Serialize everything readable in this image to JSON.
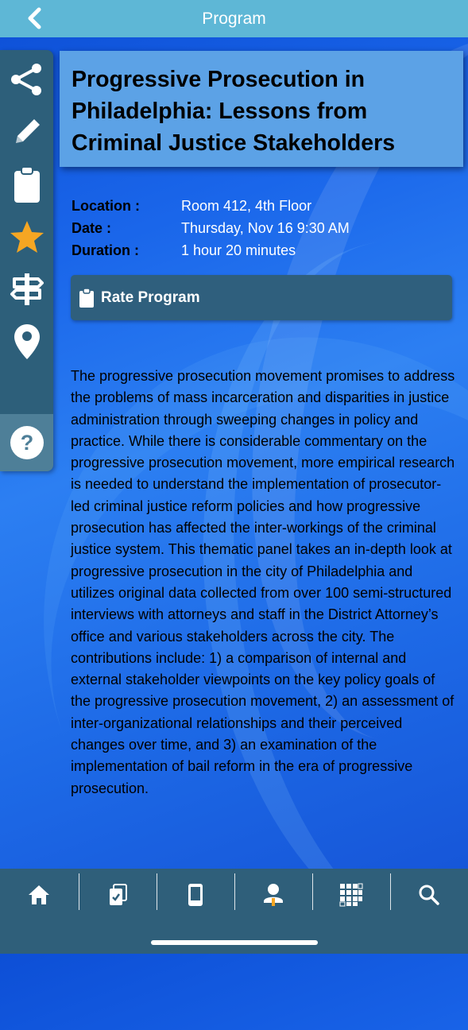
{
  "header": {
    "title": "Program",
    "back_icon": "chevron-left-icon"
  },
  "sidebar": {
    "items": [
      {
        "name": "share",
        "icon": "share-icon"
      },
      {
        "name": "notes",
        "icon": "pencil-icon"
      },
      {
        "name": "survey",
        "icon": "clipboard-icon"
      },
      {
        "name": "favorite",
        "icon": "star-icon",
        "color": "#f5a623"
      },
      {
        "name": "directions",
        "icon": "signpost-icon"
      },
      {
        "name": "map",
        "icon": "map-pin-icon"
      },
      {
        "name": "help",
        "icon": "question-icon"
      }
    ]
  },
  "program": {
    "title": "Progressive Prosecution in Philadelphia: Lessons from Criminal Justice Stakeholders",
    "location_label": "Location :",
    "location": "Room 412, 4th Floor",
    "date_label": "Date :",
    "date": "Thursday, Nov 16 9:30 AM",
    "duration_label": "Duration :",
    "duration": "1 hour 20 minutes",
    "rate_label": "Rate Program",
    "description": "The progressive prosecution movement promises to address the problems of mass incarceration and disparities in justice administration through sweeping changes in policy and practice. While there is considerable commentary on the progressive prosecution movement, more empirical research is needed to understand the implementation of prosecutor-led criminal justice reform policies and how progressive prosecution has affected the inter-workings of the criminal justice system. This thematic panel takes an in-depth look at progressive prosecution in the city of Philadelphia and utilizes original data collected from over 100 semi-structured interviews with attorneys and staff in the District Attorney’s office and various stakeholders across the city. The contributions include: 1) a comparison of internal and external stakeholder viewpoints on the key policy goals of the progressive prosecution movement, 2) an assessment of inter-organizational relationships and their perceived changes over time, and 3) an examination of the implementation of bail reform in the era of progressive prosecution."
  },
  "tabbar": {
    "tabs": [
      {
        "name": "home",
        "icon": "home-icon"
      },
      {
        "name": "my-schedule",
        "icon": "checklist-icon"
      },
      {
        "name": "program-book",
        "icon": "tablet-icon"
      },
      {
        "name": "speakers",
        "icon": "speaker-icon"
      },
      {
        "name": "apps",
        "icon": "grid-icon"
      },
      {
        "name": "search",
        "icon": "search-icon"
      }
    ]
  },
  "colors": {
    "header_bg": "#5eb7d6",
    "sidebar_bg": "#2d5f7a",
    "title_card_bg": "#5ca2e6",
    "button_bg": "#2f5f7d",
    "star": "#f5a623"
  }
}
